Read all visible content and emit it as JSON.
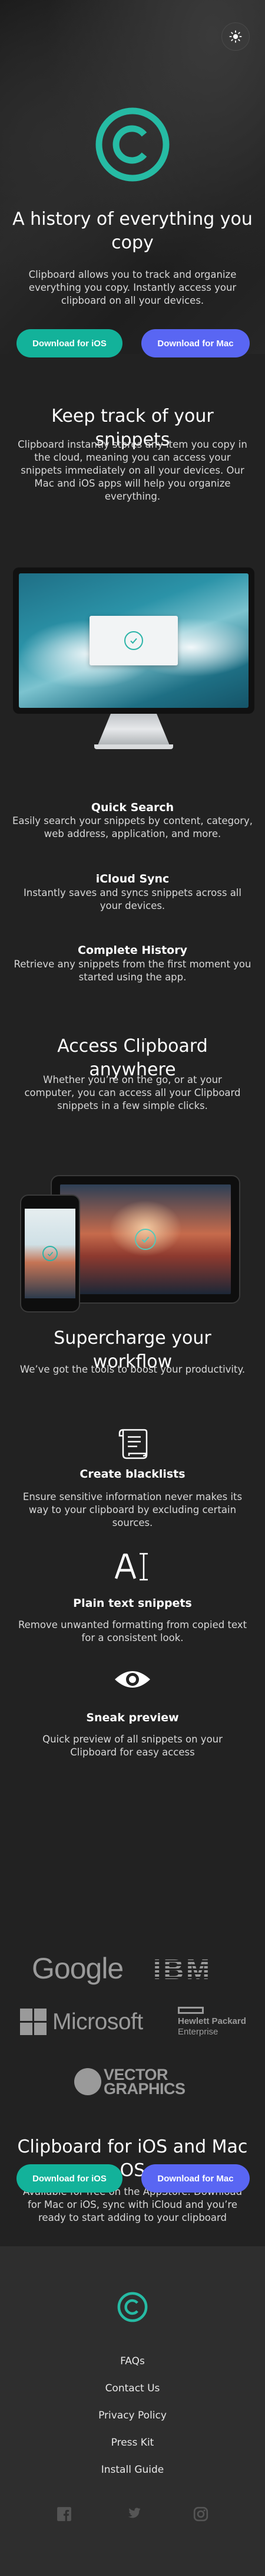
{
  "hero": {
    "title": "A history of everything you copy",
    "subtitle": "Clipboard allows you to track and organize everything you copy. Instantly access your clipboard on all your devices.",
    "ios_button": "Download for iOS",
    "mac_button": "Download for Mac"
  },
  "snippets": {
    "title": "Keep track of your snippets",
    "body": "Clipboard instantly stores any item you copy in the cloud, meaning you can access your snippets immediately on all your devices. Our Mac and iOS apps will help you organize everything."
  },
  "features": [
    {
      "title": "Quick Search",
      "body": "Easily search your snippets by content, category, web address, application, and more."
    },
    {
      "title": "iCloud Sync",
      "body": "Instantly saves and syncs snippets across all your devices."
    },
    {
      "title": "Complete History",
      "body": "Retrieve any snippets from the first moment you started using the app."
    }
  ],
  "access": {
    "title": "Access Clipboard anywhere",
    "body": "Whether you’re on the go, or at your computer, you can access all your Clipboard snippets in a few simple clicks."
  },
  "supercharge": {
    "title": "Supercharge your workflow",
    "body": "We’ve got the tools to boost your productivity.",
    "items": [
      {
        "icon": "blacklist-icon",
        "title": "Create blacklists",
        "body": "Ensure sensitive information never makes its way to your clipboard by excluding certain sources."
      },
      {
        "icon": "text-cursor-icon",
        "title": "Plain text snippets",
        "body": "Remove unwanted formatting from copied text for a consistent look."
      },
      {
        "icon": "eye-icon",
        "title": "Sneak preview",
        "body": "Quick preview of all snippets on your Clipboard for easy access"
      }
    ]
  },
  "logos": {
    "google": "Google",
    "ibm": "IBM",
    "microsoft": "Microsoft",
    "hpe_line1": "Hewlett Packard",
    "hpe_line2": "Enterprise",
    "vg_line1": "VECTOR",
    "vg_line2": "GRAPHICS"
  },
  "cta": {
    "title": "Clipboard for iOS and Mac OS",
    "body": "Available for free on the AppStore. Download for Mac or iOS, sync with iCloud and you’re ready to start adding to your clipboard",
    "ios_button": "Download for iOS",
    "mac_button": "Download for Mac"
  },
  "footer": {
    "links": [
      "FAQs",
      "Contact Us",
      "Privacy Policy",
      "Press Kit",
      "Install Guide"
    ],
    "socials": [
      "facebook-icon",
      "twitter-icon",
      "instagram-icon"
    ]
  },
  "colors": {
    "background": "#222222",
    "footer": "#2e2e2e",
    "accent_teal": "#13b29a",
    "accent_blue": "#5966f3",
    "logo_teal": "#26bba4"
  }
}
